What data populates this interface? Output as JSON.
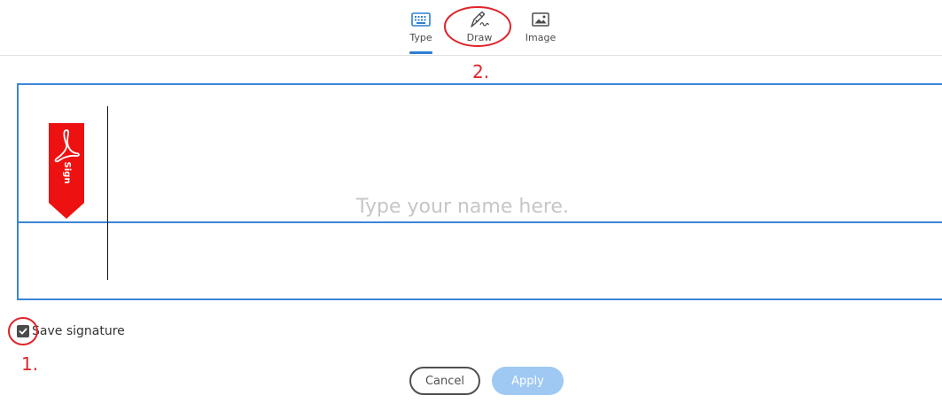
{
  "tabs": {
    "type_label": "Type",
    "draw_label": "Draw",
    "image_label": "Image",
    "active": "Type",
    "type_icon": "keyboard-icon",
    "draw_icon": "pen-nib-icon",
    "image_icon": "image-icon"
  },
  "signature": {
    "placeholder": "Type your name here.",
    "flag_icon": "acrobat-sign-flag-icon",
    "flag_text": "Sign"
  },
  "options": {
    "save_signature_label": "Save signature",
    "save_signature_checked": true
  },
  "buttons": {
    "cancel_label": "Cancel",
    "apply_label": "Apply"
  },
  "annotations": {
    "marker_1": "1.",
    "marker_2": "2."
  },
  "colors": {
    "accent": "#3b86d6",
    "apply_disabled": "#9fc9f3",
    "flag_red": "#ee1111",
    "annotation_red": "#e0242a"
  }
}
